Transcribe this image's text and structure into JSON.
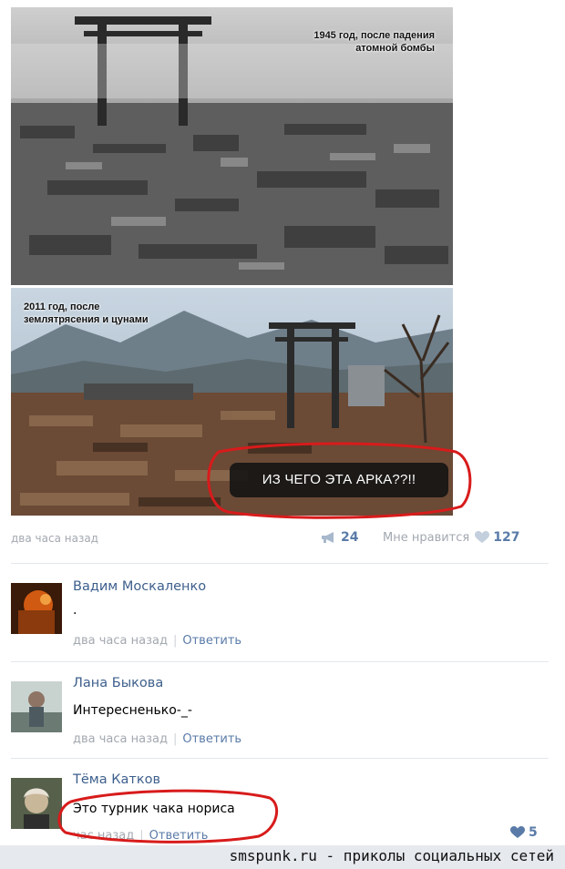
{
  "post": {
    "photo1_caption_lines": [
      "1945 год, после падения",
      "атомной бомбы"
    ],
    "photo2_caption_lines": [
      "2011 год, после",
      "землятрясения и цунами"
    ],
    "photo2_badge": "ИЗ ЧЕГО ЭТА АРКА??!!",
    "time": "два часа назад",
    "repost_count": "24",
    "like_label": "Мне нравится",
    "like_count": "127"
  },
  "comments": [
    {
      "author": "Вадим Москаленко",
      "text": ".",
      "time": "два часа назад",
      "reply_label": "Ответить",
      "avatar_icon": "user-avatar"
    },
    {
      "author": "Лана Быкова",
      "text": "Интересненько-_-",
      "time": "два часа назад",
      "reply_label": "Ответить",
      "avatar_icon": "user-avatar"
    },
    {
      "author": "Тёма Катков",
      "text": "Это турник чака нориса",
      "time": "час назад",
      "reply_label": "Ответить",
      "like_count": "5",
      "avatar_icon": "user-avatar"
    }
  ],
  "watermark": "smspunk.ru - приколы социальных сетей",
  "icons": {
    "repost": "megaphone-icon",
    "like": "heart-icon"
  },
  "colors": {
    "link": "#3d5f8c",
    "meta": "#a3a8b0",
    "counter": "#5a7ba8",
    "annotation": "#d81b1b"
  }
}
